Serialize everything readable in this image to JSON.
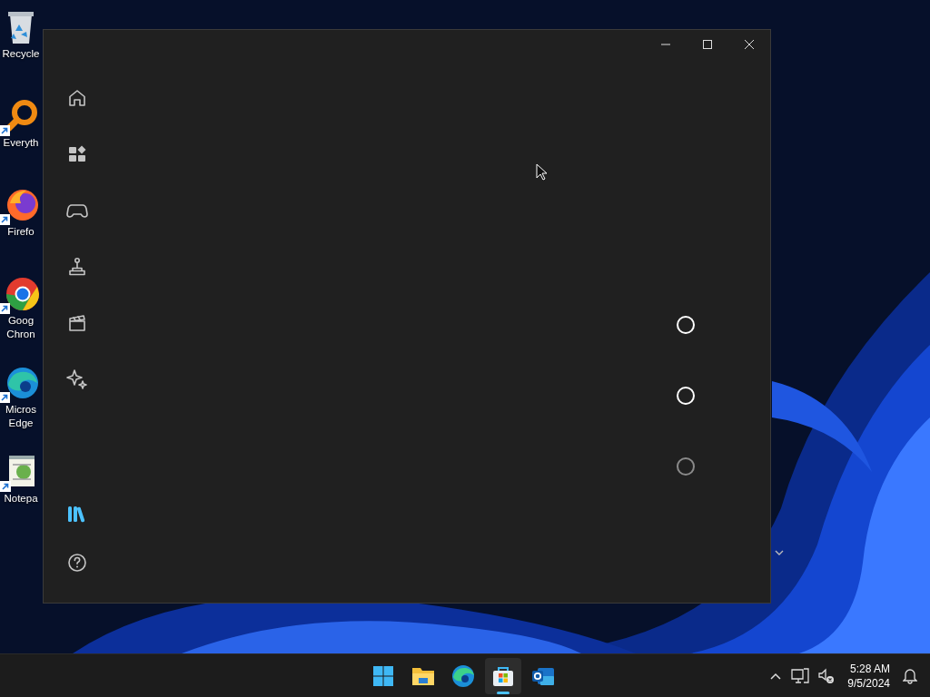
{
  "desktop": {
    "icons": [
      {
        "kind": "recycle",
        "shortcut": false,
        "label_lines": [
          "Recycle"
        ]
      },
      {
        "kind": "everything",
        "shortcut": true,
        "label_lines": [
          "Everyth"
        ]
      },
      {
        "kind": "firefox",
        "shortcut": true,
        "label_lines": [
          "Firefo"
        ]
      },
      {
        "kind": "chrome",
        "shortcut": true,
        "label_lines": [
          "Goog",
          "Chron"
        ]
      },
      {
        "kind": "edge",
        "shortcut": true,
        "label_lines": [
          "Micros",
          "Edge"
        ]
      },
      {
        "kind": "notepad",
        "shortcut": true,
        "label_lines": [
          "Notepa"
        ]
      }
    ]
  },
  "window": {
    "nav_items": [
      {
        "kind": "home",
        "selected": false
      },
      {
        "kind": "apps",
        "selected": false
      },
      {
        "kind": "gaming",
        "selected": false
      },
      {
        "kind": "arcade",
        "selected": false
      },
      {
        "kind": "movies",
        "selected": false
      },
      {
        "kind": "ai",
        "selected": false
      },
      {
        "kind": "library",
        "selected": true
      },
      {
        "kind": "help",
        "selected": false
      }
    ],
    "loading_rings": [
      {
        "dimmed": false
      },
      {
        "dimmed": false
      },
      {
        "dimmed": true
      }
    ]
  },
  "taskbar": {
    "apps": [
      {
        "kind": "start",
        "active": false
      },
      {
        "kind": "explorer",
        "active": false
      },
      {
        "kind": "edge",
        "active": false
      },
      {
        "kind": "store",
        "active": true
      },
      {
        "kind": "outlook",
        "active": false
      }
    ],
    "time": "5:28 AM",
    "date": "9/5/2024"
  }
}
